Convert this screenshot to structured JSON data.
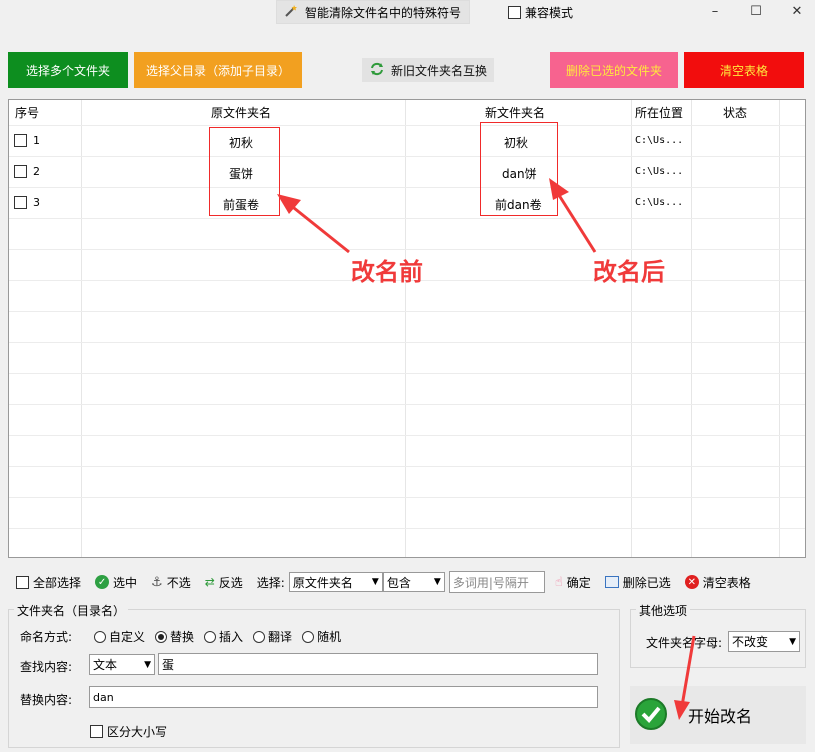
{
  "window": {
    "title": "智能清除文件名中的特殊符号",
    "compat_label": "兼容模式",
    "minimize": "–",
    "maximize": "☐",
    "close": "✕"
  },
  "topbar": {
    "select_folders": "选择多个文件夹",
    "select_parent": "选择父目录（添加子目录）",
    "swap_names": "新旧文件夹名互换",
    "delete_selected": "删除已选的文件夹",
    "clear_table": "清空表格"
  },
  "table": {
    "headers": [
      "序号",
      "原文件夹名",
      "新文件夹名",
      "所在位置",
      "状态"
    ],
    "rows": [
      {
        "index": "1",
        "original": "初秋",
        "new": "初秋",
        "location": "C:\\Us...",
        "status": ""
      },
      {
        "index": "2",
        "original": "蛋饼",
        "new": "dan饼",
        "location": "C:\\Us...",
        "status": ""
      },
      {
        "index": "3",
        "original": "前蛋卷",
        "new": "前dan卷",
        "location": "C:\\Us...",
        "status": ""
      }
    ],
    "annotation_before": "改名前",
    "annotation_after": "改名后"
  },
  "toolbar": {
    "select_all": "全部选择",
    "select": "选中",
    "deselect": "不选",
    "invert": "反选",
    "choose_label": "选择:",
    "field_select": "原文件夹名",
    "match_select": "包含",
    "keyword_placeholder": "多词用|号隔开",
    "confirm": "确定",
    "delete_selected": "删除已选",
    "clear_table": "清空表格"
  },
  "rename_panel": {
    "group_title": "文件夹名（目录名）",
    "mode_label": "命名方式:",
    "modes": [
      "自定义",
      "替换",
      "插入",
      "翻译",
      "随机"
    ],
    "selected_mode": "替换",
    "find_label": "查找内容:",
    "find_type": "文本",
    "find_value": "蛋",
    "replace_label": "替换内容:",
    "replace_value": "dan",
    "case_sensitive": "区分大小写"
  },
  "other_options": {
    "title": "其他选项",
    "letter_case_label": "文件夹名字母:",
    "letter_case_value": "不改变"
  },
  "start_button": "开始改名",
  "colors": {
    "green": "#0d8e1f",
    "orange": "#f2a020",
    "pink": "#f7638f",
    "red": "#f20d0d",
    "annotation": "#f03a3a"
  }
}
